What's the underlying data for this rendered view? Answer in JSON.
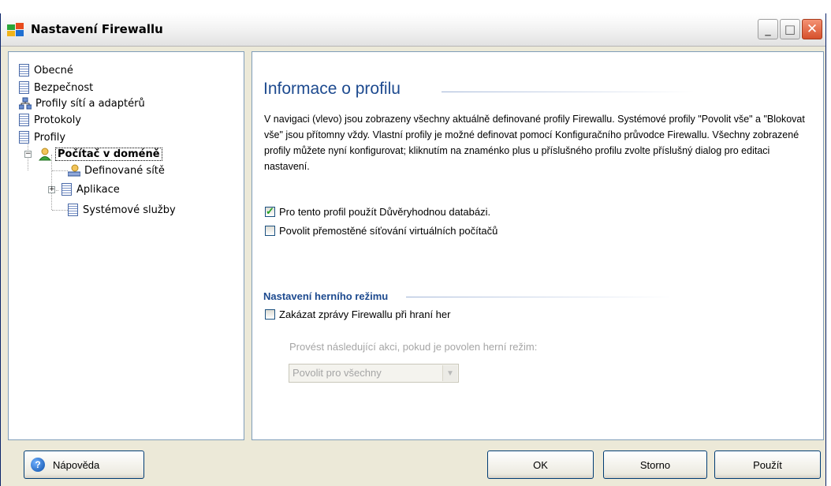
{
  "window": {
    "title": "Nastavení Firewallu",
    "accent_color": "#1d4a8f"
  },
  "titlebar_buttons": {
    "minimize_glyph": "_",
    "maximize_glyph": "□",
    "close_glyph": "✕"
  },
  "tree": {
    "items": [
      {
        "label": "Obecné",
        "icon": "document-icon"
      },
      {
        "label": "Bezpečnost",
        "icon": "document-icon"
      },
      {
        "label": "Profily sítí a adaptérů",
        "icon": "network-icon"
      },
      {
        "label": "Protokoly",
        "icon": "document-icon"
      },
      {
        "label": "Profily",
        "icon": "document-icon"
      },
      {
        "label": "Počítač v doméně",
        "icon": "user-icon",
        "selected": true,
        "expanded": true
      },
      {
        "label": "Definované sítě",
        "icon": "network-icon"
      },
      {
        "label": "Aplikace",
        "icon": "document-icon",
        "expandable": true
      },
      {
        "label": "Systémové služby",
        "icon": "document-icon"
      }
    ]
  },
  "content": {
    "heading": "Informace o profilu",
    "description": "V navigaci (vlevo) jsou zobrazeny všechny aktuálně definované profily Firewallu. Systémové profily \"Povolit vše\" a \"Blokovat vše\" jsou přítomny vždy. Vlastní profily je možné definovat pomocí Konfiguračního průvodce Firewallu. Všechny zobrazené profily můžete nyní konfigurovat; kliknutím na znaménko plus u příslušného profilu zvolte příslušný dialog pro editaci nastavení.",
    "checkbox_trusted_db": {
      "label": "Pro tento profil použít Důvěryhodnou databázi.",
      "checked": true
    },
    "checkbox_vm_bridge": {
      "label": "Povolit přemostěné síťování virtuálních počítačů",
      "checked": false
    },
    "game_mode": {
      "heading": "Nastavení herního režimu",
      "checkbox_disable_msgs": {
        "label": "Zakázat zprávy Firewallu při hraní her",
        "checked": false
      },
      "action_label": "Provést následující akci, pokud je povolen herní režim:",
      "action_select": {
        "value": "Povolit pro všechny",
        "disabled": true
      }
    }
  },
  "buttons": {
    "help": "Nápověda",
    "ok": "OK",
    "cancel": "Storno",
    "apply": "Použít"
  }
}
